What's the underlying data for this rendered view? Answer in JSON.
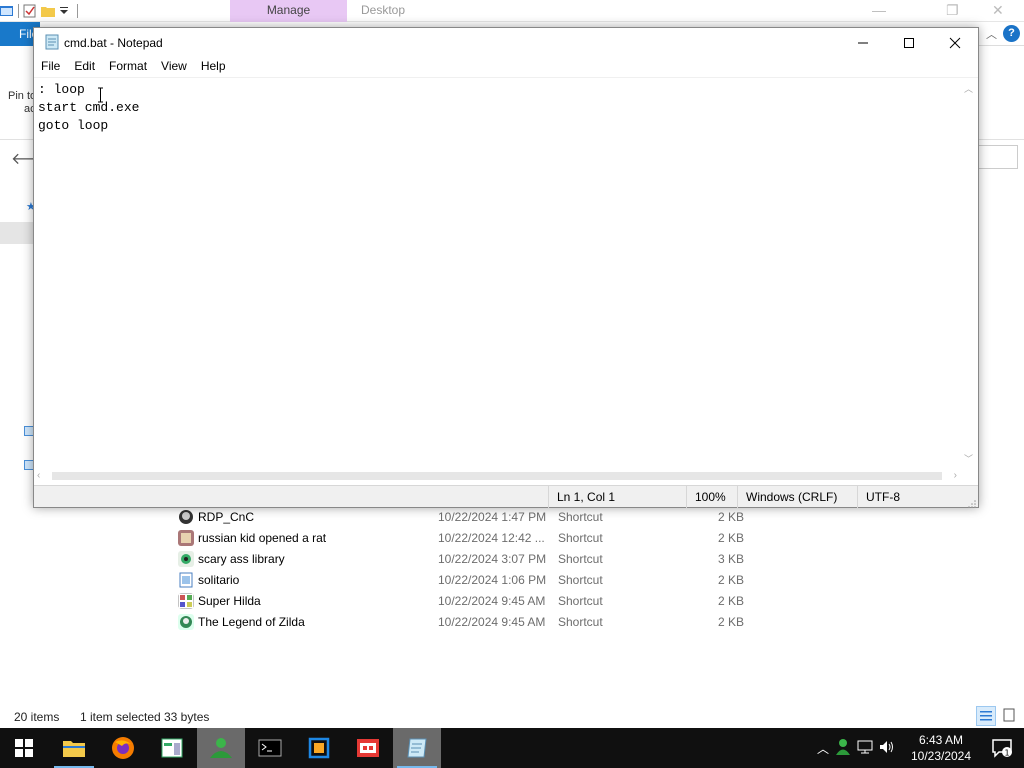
{
  "explorer": {
    "manage_tab": "Manage",
    "window_title": "Desktop",
    "file_tab": "File",
    "ribbon_pin_label": "Pin to",
    "ribbon_pin_label2": "ac",
    "files": [
      {
        "name": "RDP_CnC",
        "date": "10/22/2024 1:47 PM",
        "type": "Shortcut",
        "size": "2 KB"
      },
      {
        "name": "russian kid opened a rat",
        "date": "10/22/2024 12:42 ...",
        "type": "Shortcut",
        "size": "2 KB"
      },
      {
        "name": "scary ass library",
        "date": "10/22/2024 3:07 PM",
        "type": "Shortcut",
        "size": "3 KB"
      },
      {
        "name": "solitario",
        "date": "10/22/2024 1:06 PM",
        "type": "Shortcut",
        "size": "2 KB"
      },
      {
        "name": "Super Hilda",
        "date": "10/22/2024 9:45 AM",
        "type": "Shortcut",
        "size": "2 KB"
      },
      {
        "name": "The Legend of Zilda",
        "date": "10/22/2024 9:45 AM",
        "type": "Shortcut",
        "size": "2 KB"
      }
    ],
    "status": {
      "item_count": "20 items",
      "selected": "1 item selected",
      "size": "33 bytes"
    }
  },
  "notepad": {
    "title": "cmd.bat - Notepad",
    "menu": [
      "File",
      "Edit",
      "Format",
      "View",
      "Help"
    ],
    "content": ": loop\nstart cmd.exe\ngoto loop",
    "status": {
      "position": "Ln 1, Col 1",
      "zoom": "100%",
      "line_ending": "Windows (CRLF)",
      "encoding": "UTF-8"
    }
  },
  "taskbar": {
    "time": "6:43 AM",
    "date": "10/23/2024",
    "notification_count": "1",
    "accent": "#76b9ed"
  }
}
